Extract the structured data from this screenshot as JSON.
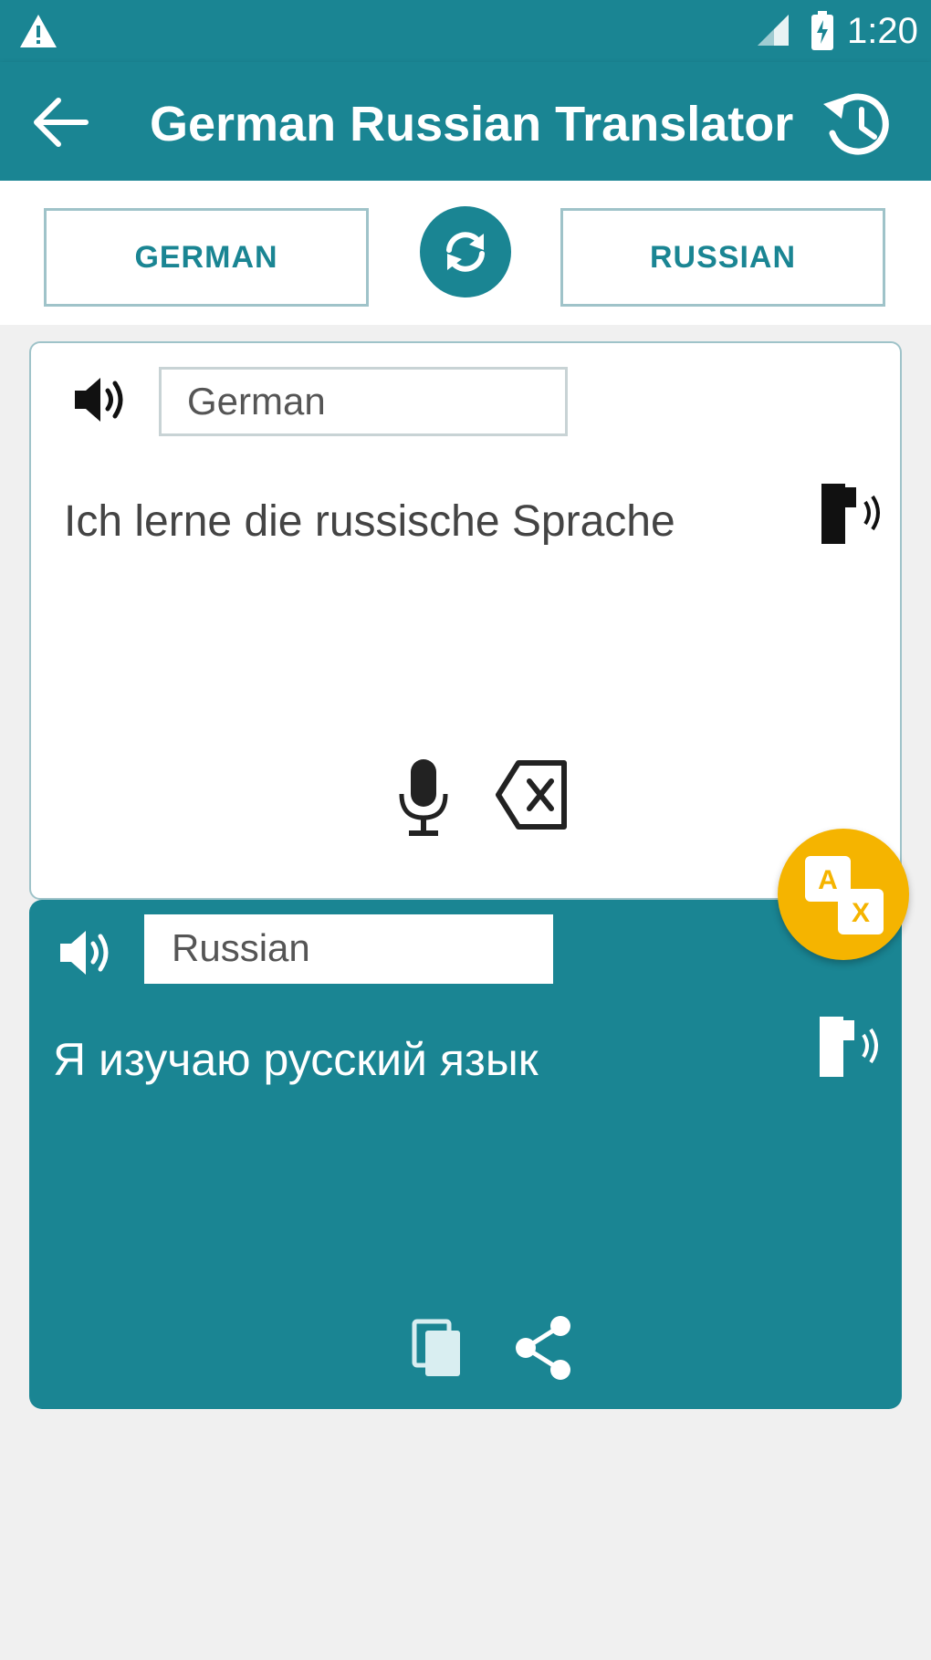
{
  "status_bar": {
    "time": "1:20"
  },
  "app_bar": {
    "title": "German Russian Translator"
  },
  "languages": {
    "source_button": "GERMAN",
    "target_button": "RUSSIAN"
  },
  "input": {
    "language_label": "German",
    "text": "Ich lerne die russische Sprache"
  },
  "output": {
    "language_label": "Russian",
    "text": "Я изучаю русский язык"
  },
  "colors": {
    "primary": "#1a8593",
    "accent": "#f5b400",
    "background": "#f0f0f0"
  },
  "icons": [
    "warning-icon",
    "signal-icon",
    "battery-icon",
    "back-arrow-icon",
    "history-icon",
    "swap-icon",
    "speaker-icon",
    "text-to-speech-icon",
    "microphone-icon",
    "clear-icon",
    "translate-icon",
    "copy-icon",
    "share-icon"
  ]
}
